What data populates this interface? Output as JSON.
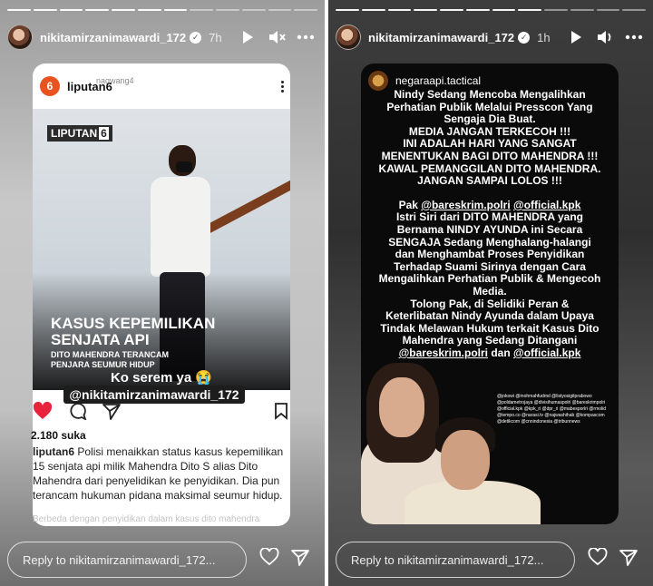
{
  "left_story": {
    "username": "nikitamirzanimawardi_172",
    "time": "7h",
    "post": {
      "account": "liputan6",
      "account_initial": "6",
      "faint_text": "naqwang4",
      "logo_text": "LIPUTAN",
      "logo_num": "6",
      "headline_line1": "KASUS KEPEMILIKAN",
      "headline_line2": "SENJATA API",
      "subheadline_line1": "DITO MAHENDRA TERANCAM",
      "subheadline_line2": "PENJARA SEUMUR HIDUP",
      "likes": "2.180 suka",
      "caption_user": "liputan6",
      "caption_text": "Polisi menaikkan status kasus kepemilikan 15 senjata api milik Mahendra Dito S alias Dito Mahendra dari penyelidikan ke penyidikan. Dia pun terancam hukuman pidana maksimal seumur hidup.",
      "caption_faint": "Berbeda dengan penyidikan dalam kasus dito mahendra"
    },
    "sticker_text": "Ko serem ya 😭",
    "mention_text": "@nikitamirzanimawardi_172",
    "reply_placeholder": "Reply to nikitamirzanimawardi_172..."
  },
  "right_story": {
    "username": "nikitamirzanimawardi_172",
    "time": "1h",
    "post": {
      "account": "negaraapi.tactical",
      "lines_block1": [
        "Nindy Sedang Mencoba Mengalihkan",
        "Perhatian Publik Melalui Presscon Yang",
        "Sengaja Dia Buat.",
        "MEDIA JANGAN TERKECOH !!!",
        "INI ADALAH HARI YANG SANGAT",
        "MENENTUKAN BAGI DITO MAHENDRA !!!",
        "KAWAL PEMANGGILAN DITO MAHENDRA.",
        "JANGAN SAMPAI LOLOS !!!"
      ],
      "pak_prefix": "Pak ",
      "mention1": "@bareskrim.polri",
      "mention2": "@official.kpk",
      "lines_block2": [
        "Istri Siri dari DITO MAHENDRA yang",
        "Bernama NINDY AYUNDA ini Secara",
        "SENGAJA Sedang Menghalang-halangi",
        "dan Menghambat Proses Penyidikan",
        "Terhadap Suami Sirinya dengan Cara",
        "Mengalihkan Perhatian Publik & Mengecoh",
        "Media.",
        "Tolong Pak, di Selidiki Peran &",
        "Keterlibatan Nindy Ayunda dalam Upaya",
        "Tindak Melawan Hukum terkait Kasus Dito",
        "Mahendra yang Sedang Ditangani"
      ],
      "final_mention1": "@bareskrim.polri",
      "final_dan": " dan ",
      "final_mention2": "@official.kpk",
      "tag_cloud": "@jokowi @mohmahfudmd @listyosigitprabowo @poldametrojaya @divisihumaspolri @bareskrimpolri @official.kpk @kpk_ri @dpr_ri @mabesporlri @rmolid @tempo.co @narasi.tv @najwashihab @kompascom @detikcom @cnnindonesia @tribunnews"
    },
    "reply_placeholder": "Reply to nikitamirzanimawardi_172..."
  }
}
